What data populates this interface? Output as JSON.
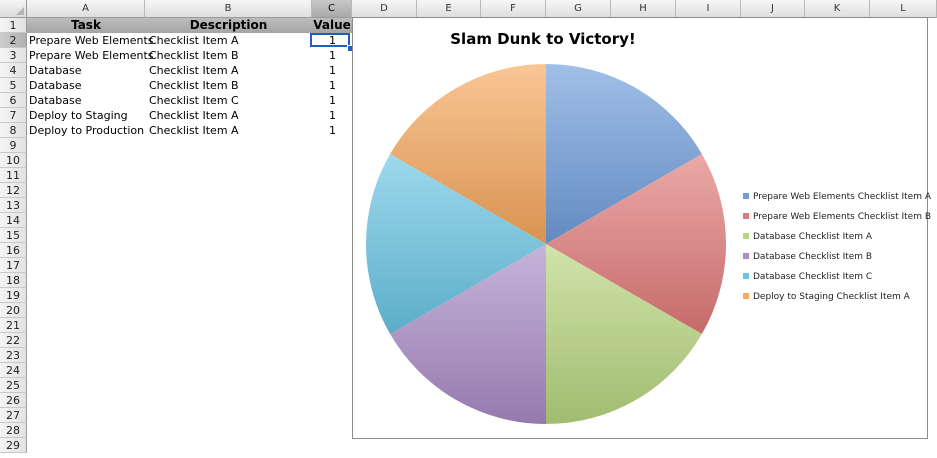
{
  "columns": [
    "A",
    "B",
    "C",
    "D",
    "E",
    "F",
    "G",
    "H",
    "I",
    "J",
    "K",
    "L"
  ],
  "rows": [
    "1",
    "2",
    "3",
    "4",
    "5",
    "6",
    "7",
    "8",
    "9",
    "10",
    "11",
    "12",
    "13",
    "14",
    "15",
    "16",
    "17",
    "18",
    "19",
    "20",
    "21",
    "22",
    "23",
    "24",
    "25",
    "26",
    "27",
    "28",
    "29"
  ],
  "headers": {
    "task": "Task",
    "description": "Description",
    "value": "Value"
  },
  "table": [
    {
      "task": "Prepare Web Elements",
      "description": "Checklist Item A",
      "value": "1"
    },
    {
      "task": "Prepare Web Elements",
      "description": "Checklist Item B",
      "value": "1"
    },
    {
      "task": "Database",
      "description": "Checklist Item A",
      "value": "1"
    },
    {
      "task": "Database",
      "description": "Checklist Item B",
      "value": "1"
    },
    {
      "task": "Database",
      "description": "Checklist Item C",
      "value": "1"
    },
    {
      "task": "Deploy to Staging",
      "description": "Checklist Item A",
      "value": "1"
    },
    {
      "task": "Deploy to Production",
      "description": "Checklist Item A",
      "value": "1"
    }
  ],
  "selection": {
    "column": "C",
    "row": "2"
  },
  "chart_data": {
    "type": "pie",
    "title": "Slam Dunk to Victory!",
    "categories": [
      "Prepare Web Elements Checklist Item A",
      "Prepare Web Elements Checklist Item B",
      "Database Checklist Item A",
      "Database Checklist Item B",
      "Database Checklist Item C",
      "Deploy to Staging Checklist Item A"
    ],
    "values": [
      1,
      1,
      1,
      1,
      1,
      1
    ],
    "colors": [
      "#6f9ddb",
      "#e07a78",
      "#b7d67e",
      "#a98bc6",
      "#68c5e3",
      "#f6a75c"
    ],
    "legend_position": "right"
  }
}
